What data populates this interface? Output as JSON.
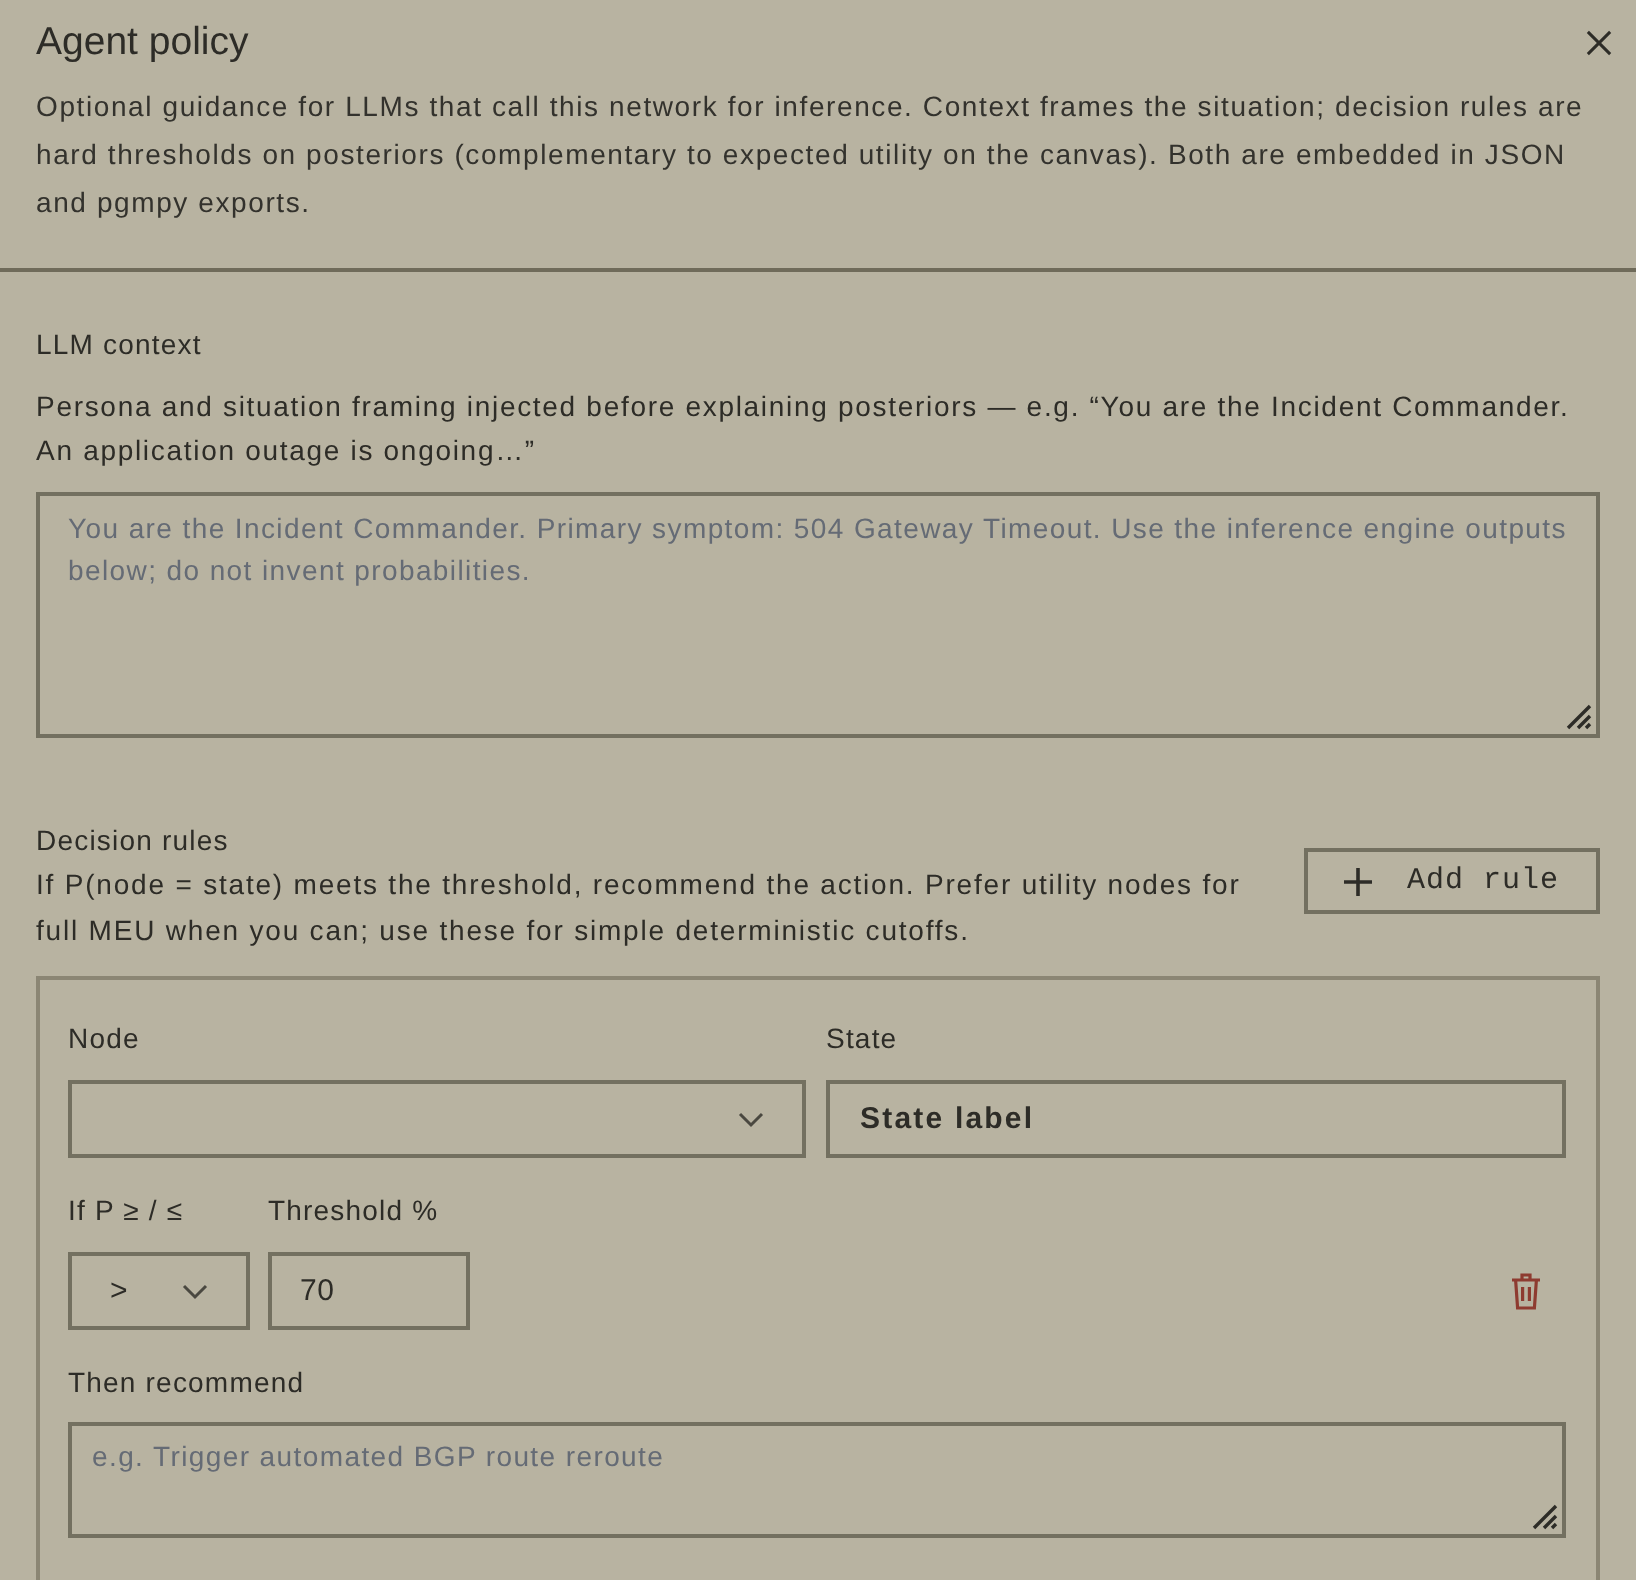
{
  "dialog": {
    "title": "Agent policy",
    "description": "Optional guidance for LLMs that call this network for inference. Context frames the situation; decision rules are hard thresholds on posteriors (complementary to expected utility on the canvas). Both are embedded in JSON and pgmpy exports."
  },
  "llm_context": {
    "label": "LLM context",
    "help": "Persona and situation framing injected before explaining posteriors — e.g. “You are the Incident Commander. An application outage is ongoing…”",
    "placeholder": "You are the Incident Commander. Primary symptom: 504 Gateway Timeout. Use the inference engine outputs below; do not invent probabilities."
  },
  "decision_rules": {
    "label": "Decision rules",
    "help": "If P(node = state) meets the threshold, recommend the action. Prefer utility nodes for full MEU when you can; use these for simple deterministic cutoffs.",
    "add_button": "Add rule",
    "rules": [
      {
        "node_label": "Node",
        "state_label": "State",
        "state_value": "State label",
        "comparator_label": "If P ≥ / ≤",
        "comparator": ">",
        "threshold_label": "Threshold %",
        "threshold": "70",
        "recommend_label": "Then recommend",
        "recommend_placeholder": "e.g. Trigger automated BGP route reroute"
      }
    ]
  }
}
